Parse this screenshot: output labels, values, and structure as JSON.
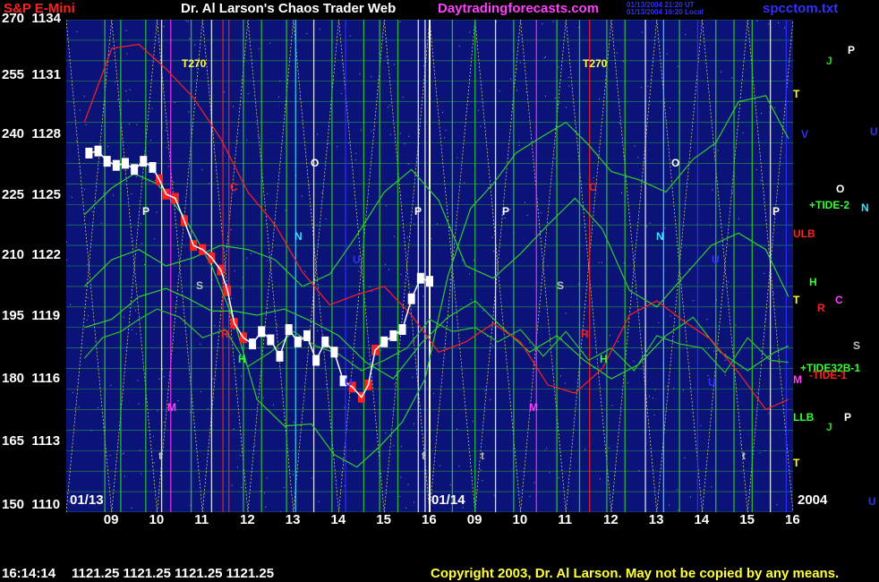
{
  "header": {
    "symbol": "S&P E-Mini",
    "title": "Dr. Al Larson's Chaos Trader Web",
    "site": "Daytradingforecasts.com",
    "ts1": "01/13/2004 21:20 UT",
    "ts2": "01/13/2004 16:20 Local",
    "file": "spcctom.txt"
  },
  "colors": {
    "background": "#000000",
    "plot_bg": "#0b1378",
    "grid_green": "#2fcf2f",
    "grid_yellow": "#e8e070",
    "red": "#ff2020",
    "blue": "#3030ff",
    "white": "#ffffff",
    "magenta": "#ff30ff"
  },
  "chart_data": {
    "type": "line",
    "title": "S&P E-Mini",
    "y_left_outer_ticks": [
      "270",
      "255",
      "240",
      "225",
      "210",
      "195",
      "180",
      "165",
      "150"
    ],
    "y_left_ticks": [
      "1134",
      "1131",
      "1128",
      "1125",
      "1122",
      "1119",
      "1116",
      "1113",
      "1110"
    ],
    "ylim": [
      1110,
      1134
    ],
    "x_ticks": [
      "09",
      "10",
      "11",
      "12",
      "13",
      "14",
      "15",
      "16",
      "09",
      "10",
      "11",
      "12",
      "13",
      "14",
      "15",
      "16"
    ],
    "date_labels": [
      "01/13",
      "01/14"
    ],
    "year_label": "2004",
    "price_series": {
      "name": "price",
      "x": [
        8.5,
        8.7,
        8.9,
        9.1,
        9.3,
        9.5,
        9.7,
        9.9,
        10.05,
        10.2,
        10.4,
        10.6,
        10.8,
        11.0,
        11.2,
        11.4,
        11.55,
        11.7,
        11.9,
        12.1,
        12.3,
        12.5,
        12.7,
        12.9,
        13.1,
        13.3,
        13.5,
        13.7,
        13.9,
        14.1,
        14.3,
        14.5,
        14.65,
        14.8,
        15.0,
        15.2,
        15.4,
        15.6,
        15.8,
        16.0
      ],
      "y": [
        1127.5,
        1127.6,
        1127.1,
        1126.9,
        1127.0,
        1126.7,
        1127.1,
        1126.8,
        1126.2,
        1125.5,
        1125.3,
        1124.2,
        1123.0,
        1122.8,
        1122.4,
        1121.8,
        1120.8,
        1119.2,
        1118.5,
        1118.2,
        1118.8,
        1118.4,
        1117.6,
        1118.9,
        1118.3,
        1118.6,
        1117.4,
        1118.3,
        1117.8,
        1116.4,
        1116.1,
        1115.6,
        1116.2,
        1117.9,
        1118.3,
        1118.6,
        1118.9,
        1120.4,
        1121.4,
        1121.25
      ]
    },
    "forecast_series": [
      {
        "x": [
          8.4,
          9.0,
          9.5,
          10.0,
          10.6,
          11.2,
          11.7,
          12.2,
          12.8,
          13.4,
          13.9,
          14.4,
          14.9,
          15.4,
          15.9,
          16.4,
          16.9,
          17.4,
          17.9,
          18.4,
          19.0,
          19.5,
          20.0,
          20.6,
          21.2,
          21.8,
          22.3,
          22.8,
          23.4,
          23.9
        ],
        "y": [
          1124.5,
          1125.8,
          1126.5,
          1126.0,
          1124.4,
          1122.0,
          1119.3,
          1115.5,
          1114.2,
          1114.3,
          1112.8,
          1112.2,
          1113.2,
          1114.4,
          1116.5,
          1121.5,
          1124.8,
          1126.0,
          1127.5,
          1128.2,
          1129.0,
          1127.9,
          1126.6,
          1126.2,
          1125.6,
          1127.2,
          1128.0,
          1130.0,
          1130.3,
          1128.2
        ]
      },
      {
        "x": [
          8.4,
          9.0,
          9.6,
          10.2,
          10.8,
          11.4,
          12.0,
          12.6,
          13.2,
          13.8,
          14.4,
          15.0,
          15.6,
          16.2,
          16.8,
          17.4,
          18.0,
          18.6,
          19.2,
          19.8,
          20.4,
          21.0,
          21.6,
          22.2,
          22.8,
          23.4,
          23.9
        ],
        "y": [
          1121.0,
          1122.3,
          1122.8,
          1122.0,
          1122.4,
          1123.0,
          1122.8,
          1122.3,
          1121.0,
          1121.6,
          1123.5,
          1125.6,
          1126.7,
          1125.2,
          1122.0,
          1121.4,
          1122.6,
          1124.0,
          1125.3,
          1123.8,
          1120.8,
          1120.0,
          1121.5,
          1123.0,
          1123.6,
          1122.8,
          1120.5
        ]
      },
      {
        "x": [
          8.4,
          9.0,
          9.6,
          10.2,
          10.7,
          11.2,
          11.7,
          12.2,
          12.8,
          13.4,
          14.0,
          14.6,
          15.2,
          15.8,
          16.4,
          17.0,
          17.6,
          18.2,
          18.8,
          19.4,
          20.0,
          20.6,
          21.2,
          21.8,
          22.4,
          23.0,
          23.6,
          23.9
        ],
        "y": [
          1119.0,
          1119.4,
          1120.5,
          1120.9,
          1120.4,
          1119.8,
          1119.8,
          1119.6,
          1119.9,
          1119.3,
          1118.6,
          1117.3,
          1116.5,
          1118.2,
          1119.5,
          1120.3,
          1119.0,
          1117.8,
          1118.6,
          1117.4,
          1116.5,
          1117.2,
          1118.6,
          1119.5,
          1117.8,
          1116.9,
          1117.8,
          1118.1
        ]
      },
      {
        "x": [
          8.4,
          8.8,
          9.2,
          9.6,
          10.0,
          10.5,
          11.0,
          11.5,
          12.0,
          12.5,
          13.0,
          13.5,
          14.0,
          14.5,
          15.0,
          15.5,
          16.0,
          16.5,
          17.0,
          17.5,
          18.0,
          18.5,
          19.0,
          19.5,
          20.0,
          20.5,
          21.0,
          21.5,
          22.0,
          22.5,
          23.0,
          23.5,
          23.9
        ],
        "y": [
          1117.5,
          1118.5,
          1118.8,
          1119.4,
          1119.9,
          1119.5,
          1118.5,
          1118.9,
          1117.1,
          1117.8,
          1118.8,
          1118.1,
          1117.7,
          1116.9,
          1117.4,
          1118.0,
          1119.4,
          1118.8,
          1119.0,
          1118.3,
          1118.9,
          1117.6,
          1118.8,
          1117.4,
          1118.0,
          1116.9,
          1118.6,
          1118.2,
          1118.0,
          1116.8,
          1118.5,
          1117.4,
          1117.3
        ]
      },
      {
        "x": [
          8.4,
          9.0,
          9.6,
          10.2,
          10.8,
          11.4,
          12.0,
          12.6,
          13.2,
          13.8,
          14.4,
          15.0,
          15.6,
          16.2,
          16.8,
          17.4,
          18.0,
          18.6,
          19.2,
          19.8,
          20.4,
          21.0,
          21.6,
          22.2,
          22.8,
          23.4,
          23.9
        ],
        "y": [
          1129.0,
          1132.6,
          1132.8,
          1131.6,
          1130.2,
          1128.2,
          1125.6,
          1124.0,
          1121.7,
          1120.1,
          1120.6,
          1121.0,
          1119.6,
          1117.8,
          1118.3,
          1119.2,
          1118.3,
          1116.2,
          1115.8,
          1117.0,
          1119.6,
          1120.3,
          1119.3,
          1118.4,
          1116.8,
          1115.0,
          1115.5
        ]
      }
    ],
    "right_labels": [
      {
        "text": "P",
        "color": "#ffffff",
        "x": 947,
        "y": 57
      },
      {
        "text": "J",
        "color": "#30d030",
        "x": 923,
        "y": 69
      },
      {
        "text": "T",
        "color": "#ffff40",
        "x": 886,
        "y": 106
      },
      {
        "text": "V",
        "color": "#3030ff",
        "x": 895,
        "y": 151
      },
      {
        "text": "U",
        "color": "#3030ff",
        "x": 972,
        "y": 148
      },
      {
        "text": "O",
        "color": "#ffffff",
        "x": 934,
        "y": 212
      },
      {
        "text": "+TIDE-2",
        "color": "#30ff30",
        "x": 904,
        "y": 230
      },
      {
        "text": "N",
        "color": "#40e0ff",
        "x": 962,
        "y": 233
      },
      {
        "text": "ULB",
        "color": "#ff2020",
        "x": 886,
        "y": 262
      },
      {
        "text": "H",
        "color": "#30ff30",
        "x": 904,
        "y": 316
      },
      {
        "text": "C",
        "color": "#ff40ff",
        "x": 933,
        "y": 336
      },
      {
        "text": "T",
        "color": "#ffff40",
        "x": 886,
        "y": 336
      },
      {
        "text": "R",
        "color": "#ff2020",
        "x": 913,
        "y": 345
      },
      {
        "text": "S",
        "color": "#c0c0c0",
        "x": 953,
        "y": 387
      },
      {
        "text": "+TIDE32B-1",
        "color": "#30ff30",
        "x": 894,
        "y": 412
      },
      {
        "text": "-TIDE-1",
        "color": "#ff2020",
        "x": 904,
        "y": 420
      },
      {
        "text": "M",
        "color": "#ff40ff",
        "x": 886,
        "y": 425
      },
      {
        "text": "LLB",
        "color": "#30ff30",
        "x": 886,
        "y": 467
      },
      {
        "text": "P",
        "color": "#ffffff",
        "x": 943,
        "y": 467
      },
      {
        "text": "J",
        "color": "#30d030",
        "x": 923,
        "y": 478
      },
      {
        "text": "T",
        "color": "#ffff40",
        "x": 886,
        "y": 518
      },
      {
        "text": "U",
        "color": "#3030ff",
        "x": 970,
        "y": 561
      }
    ],
    "plot_labels": [
      {
        "text": "T270",
        "color": "#ffff40",
        "x": 203,
        "y": 72
      },
      {
        "text": "T270",
        "color": "#ffff40",
        "x": 651,
        "y": 72
      },
      {
        "text": "O",
        "color": "#ffffff",
        "x": 347,
        "y": 183
      },
      {
        "text": "O",
        "color": "#ffffff",
        "x": 750,
        "y": 183
      },
      {
        "text": "C",
        "color": "#ff2020",
        "x": 257,
        "y": 210
      },
      {
        "text": "C",
        "color": "#ff2020",
        "x": 658,
        "y": 210
      },
      {
        "text": "P",
        "color": "#ffffff",
        "x": 159,
        "y": 237
      },
      {
        "text": "P",
        "color": "#ffffff",
        "x": 463,
        "y": 237
      },
      {
        "text": "P",
        "color": "#ffffff",
        "x": 561,
        "y": 237
      },
      {
        "text": "P",
        "color": "#ffffff",
        "x": 863,
        "y": 237
      },
      {
        "text": "N",
        "color": "#40e0ff",
        "x": 329,
        "y": 265
      },
      {
        "text": "N",
        "color": "#40e0ff",
        "x": 733,
        "y": 265
      },
      {
        "text": "U",
        "color": "#3030ff",
        "x": 394,
        "y": 291
      },
      {
        "text": "U",
        "color": "#3030ff",
        "x": 795,
        "y": 291
      },
      {
        "text": "S",
        "color": "#c0c0c0",
        "x": 219,
        "y": 320
      },
      {
        "text": "S",
        "color": "#c0c0c0",
        "x": 622,
        "y": 320
      },
      {
        "text": "R",
        "color": "#ff2020",
        "x": 247,
        "y": 374
      },
      {
        "text": "R",
        "color": "#ff2020",
        "x": 649,
        "y": 374
      },
      {
        "text": "H",
        "color": "#30ff30",
        "x": 266,
        "y": 402
      },
      {
        "text": "H",
        "color": "#30ff30",
        "x": 670,
        "y": 402
      },
      {
        "text": "U",
        "color": "#3030ff",
        "x": 385,
        "y": 428
      },
      {
        "text": "U",
        "color": "#3030ff",
        "x": 791,
        "y": 428
      },
      {
        "text": "M",
        "color": "#ff40ff",
        "x": 187,
        "y": 456
      },
      {
        "text": "M",
        "color": "#ff40ff",
        "x": 591,
        "y": 456
      },
      {
        "text": "t",
        "color": "#c0c0c0",
        "x": 177,
        "y": 510
      },
      {
        "text": "t",
        "color": "#c0c0c0",
        "x": 471,
        "y": 510
      },
      {
        "text": "t",
        "color": "#c0c0c0",
        "x": 537,
        "y": 510
      },
      {
        "text": "t",
        "color": "#c0c0c0",
        "x": 829,
        "y": 510
      }
    ]
  },
  "footer": {
    "time": "16:14:14",
    "quotes": "1121.25 1121.25 1121.25 1121.25",
    "copyright": "Copyright 2003, Dr. Al Larson. May not be copied by any means."
  }
}
